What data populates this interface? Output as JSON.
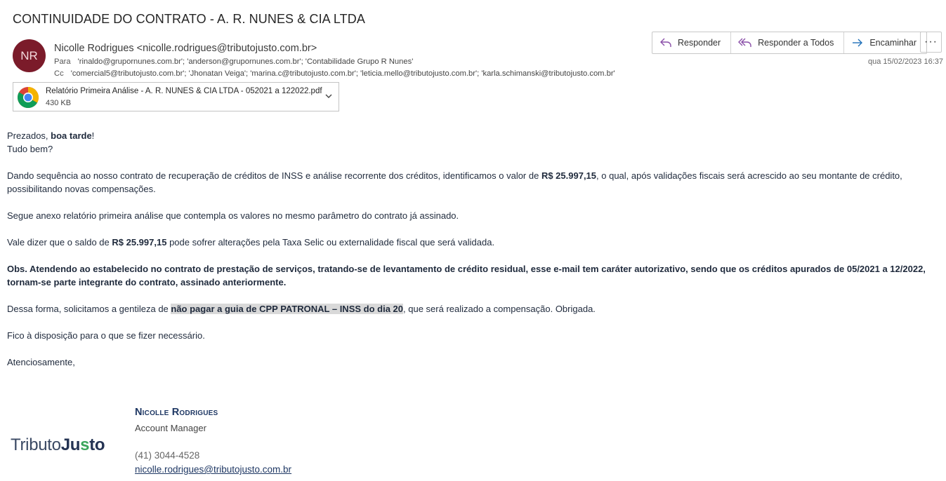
{
  "subject": "CONTINUIDADE DO CONTRATO - A. R. NUNES & CIA LTDA",
  "sender": {
    "initials": "NR",
    "display": "Nicolle Rodrigues <nicolle.rodrigues@tributojusto.com.br>",
    "avatar_color": "#7b1b2a"
  },
  "recipients": {
    "to_label": "Para",
    "to": "'rinaldo@grupornunes.com.br'; 'anderson@grupornunes.com.br'; 'Contabilidade Grupo R Nunes'",
    "cc_label": "Cc",
    "cc": "'comercial5@tributojusto.com.br'; 'Jhonatan Veiga'; 'marina.c@tributojusto.com.br'; 'leticia.mello@tributojusto.com.br'; 'karla.schimanski@tributojusto.com.br'"
  },
  "actions": {
    "reply": "Responder",
    "reply_all": "Responder a Todos",
    "forward": "Encaminhar",
    "more": "···"
  },
  "date": "qua 15/02/2023 16:37",
  "attachment": {
    "name": "Relatório Primeira Análise - A. R. NUNES & CIA LTDA - 052021 a 122022.pdf",
    "size": "430 KB",
    "icon": "chrome-icon"
  },
  "body": {
    "greeting_a": "Prezados, ",
    "greeting_b": "boa tarde",
    "greeting_c": "!",
    "line2": "Tudo bem?",
    "p1_a": "Dando sequência ao nosso contrato de recuperação de créditos de INSS e análise recorrente dos créditos, identificamos o valor de ",
    "p1_b": "R$ 25.997,15",
    "p1_c": ", o qual, após validações fiscais será acrescido ao seu montante de crédito, possibilitando novas compensações.",
    "p2": "Segue anexo relatório primeira análise que contempla os valores no mesmo parâmetro do contrato já assinado.",
    "p3_a": "Vale dizer que o saldo de ",
    "p3_b": "R$ 25.997,15",
    "p3_c": " pode sofrer alterações pela Taxa Selic ou externalidade fiscal que será validada.",
    "p4": "Obs. Atendendo ao estabelecido no contrato de prestação de serviços, tratando-se de levantamento de crédito residual, esse e-mail tem caráter autorizativo, sendo que os créditos apurados de 05/2021 a 12/2022, tornam-se parte integrante do contrato, assinado anteriormente.",
    "p5_a": "Dessa forma, solicitamos a gentileza de ",
    "p5_b": "não pagar a guia de CPP PATRONAL – INSS do dia 20",
    "p5_c": ", que será realizado a compensação. Obrigada.",
    "p6": "Fico à disposição para o que se fizer necessário.",
    "p7": "Atenciosamente,"
  },
  "signature": {
    "name": "Nicolle Rodrigues",
    "role": "Account Manager",
    "phone": "(41) 3044-4528",
    "email": "nicolle.rodrigues@tributojusto.com.br",
    "logo_a": "Tributo",
    "logo_b": "Ju",
    "logo_c": "s",
    "logo_d": "to"
  }
}
